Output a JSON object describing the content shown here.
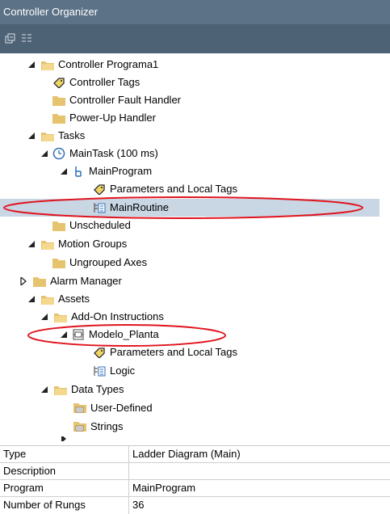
{
  "window": {
    "title": "Controller Organizer"
  },
  "toolbar": {
    "buttons": [
      "collapse-all-icon",
      "expand-all-icon"
    ]
  },
  "tree": {
    "controller": "Controller Programa1",
    "controller_tags": "Controller Tags",
    "fault_handler": "Controller Fault Handler",
    "powerup_handler": "Power-Up Handler",
    "tasks": "Tasks",
    "main_task": "MainTask (100 ms)",
    "main_program": "MainProgram",
    "params_local_tags_1": "Parameters and Local Tags",
    "main_routine": "MainRoutine",
    "unscheduled": "Unscheduled",
    "motion_groups": "Motion Groups",
    "ungrouped_axes": "Ungrouped Axes",
    "alarm_manager": "Alarm Manager",
    "assets": "Assets",
    "add_on_instructions": "Add-On Instructions",
    "modelo_planta": "Modelo_Planta",
    "params_local_tags_2": "Parameters and Local Tags",
    "logic": "Logic",
    "data_types": "Data Types",
    "user_defined": "User-Defined",
    "strings": "Strings"
  },
  "properties": [
    {
      "key": "Type",
      "value": "Ladder Diagram (Main)"
    },
    {
      "key": "Description",
      "value": ""
    },
    {
      "key": "Program",
      "value": "MainProgram"
    },
    {
      "key": "Number of Rungs",
      "value": "36"
    }
  ],
  "colors": {
    "title_bg": "#5b7287",
    "toolbar_bg": "#4e6275",
    "selection": "#c9d6e4",
    "annotation_oval": "#e0141e",
    "folder": "#e6c36e"
  }
}
